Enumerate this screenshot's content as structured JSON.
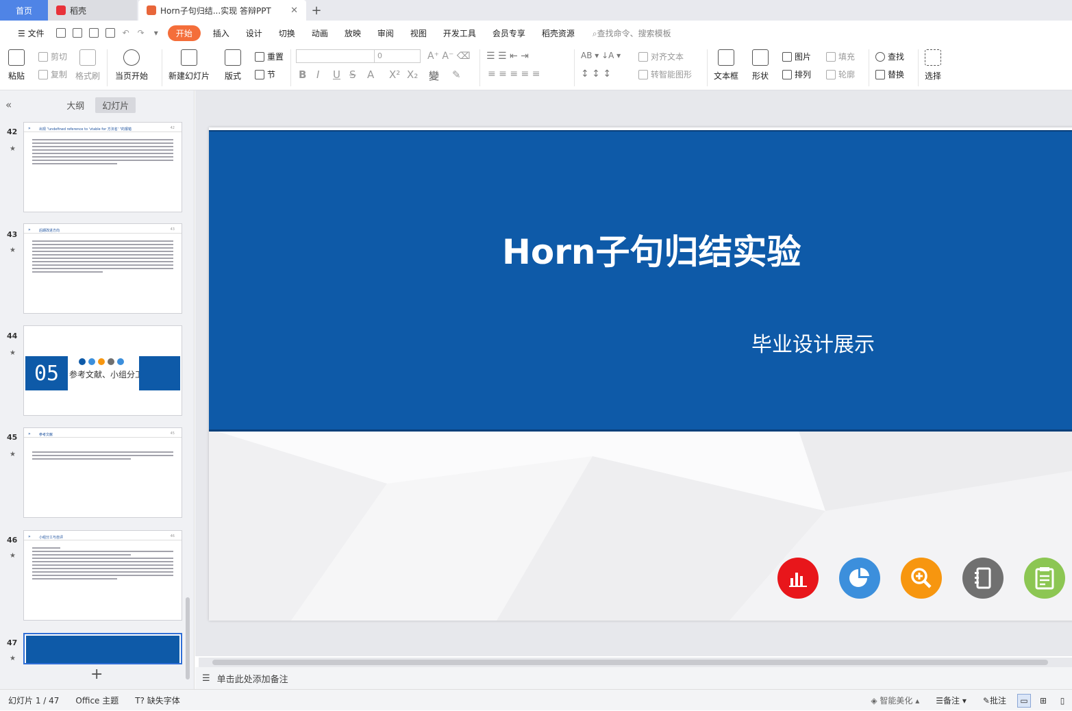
{
  "tabs": {
    "home": "首页",
    "daoke": "稻壳",
    "doc": "Horn子句归结...实现 答辩PPT"
  },
  "menu": {
    "file": "文件",
    "items": [
      "开始",
      "插入",
      "设计",
      "切换",
      "动画",
      "放映",
      "审阅",
      "视图",
      "开发工具",
      "会员专享",
      "稻壳资源"
    ],
    "search": "查找命令、搜索模板"
  },
  "ribbon": {
    "paste": "粘贴",
    "cut": "剪切",
    "copy": "复制",
    "format_painter": "格式刷",
    "from_current": "当页开始",
    "new_slide": "新建幻灯片",
    "layout": "版式",
    "reset": "重置",
    "section": "节",
    "font_size": "0",
    "align_text": "对齐文本",
    "smart_art": "转智能图形",
    "textbox": "文本框",
    "shape": "形状",
    "picture": "图片",
    "arrange": "排列",
    "fill": "填充",
    "outline": "轮廓",
    "find": "查找",
    "replace": "替换",
    "select": "选择"
  },
  "left_panel": {
    "outline_tab": "大纲",
    "slides_tab": "幻灯片",
    "thumbs": [
      {
        "num": "42",
        "title": "出现 \"undefined reference to 'vtable for 方法名' \"的报错",
        "page": "42"
      },
      {
        "num": "43",
        "title": "后期改进方向",
        "page": "43"
      },
      {
        "num": "44",
        "big": "05",
        "caption": "参考文献、小组分工"
      },
      {
        "num": "45",
        "title": "参考文献",
        "page": "45"
      },
      {
        "num": "46",
        "title": "小组分工与自评",
        "page": "46"
      },
      {
        "num": "47"
      }
    ]
  },
  "slide": {
    "title": "Horn子句归结实验",
    "subtitle": "毕业设计展示",
    "icon_colors": [
      "#e8161b",
      "#3c8fdc",
      "#f7960f",
      "#707070",
      "#8cc653"
    ]
  },
  "notes": {
    "placeholder": "单击此处添加备注"
  },
  "status": {
    "slide_count": "幻灯片 1 / 47",
    "theme": "Office 主题",
    "missing_font": "缺失字体",
    "beautify": "智能美化",
    "notes": "备注",
    "comment": "批注"
  }
}
